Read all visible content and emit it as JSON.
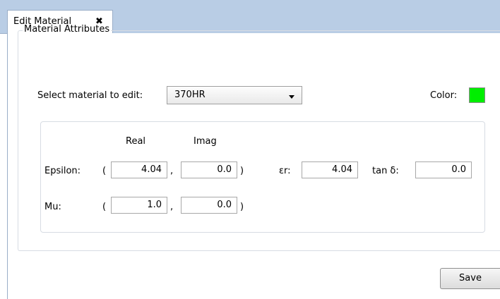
{
  "tab": {
    "label": "Edit Material",
    "close_glyph": "✖"
  },
  "group": {
    "title": "Material Attributes"
  },
  "select": {
    "label": "Select material to edit:",
    "value": "370HR"
  },
  "color": {
    "label": "Color:",
    "value": "#00ee00"
  },
  "columns": {
    "real": "Real",
    "imag": "Imag"
  },
  "epsilon": {
    "label": "Epsilon:",
    "open": "(",
    "comma": ",",
    "close": ")",
    "real": "4.04",
    "imag": "0.0"
  },
  "mu": {
    "label": "Mu:",
    "open": "(",
    "comma": ",",
    "close": ")",
    "real": "1.0",
    "imag": "0.0"
  },
  "er": {
    "label": "εr:",
    "value": "4.04"
  },
  "tand": {
    "label": "tan δ:",
    "value": "0.0"
  },
  "actions": {
    "save": "Save"
  }
}
